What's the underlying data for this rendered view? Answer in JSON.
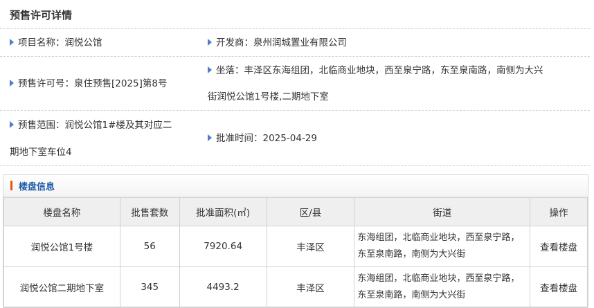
{
  "page": {
    "title": "预售许可详情"
  },
  "info": {
    "project_name": "项目名称：润悦公馆",
    "developer": "开发商：泉州润城置业有限公司",
    "permit_no": "预售许可号：泉住预售[2025]第8号",
    "location_line1": "坐落：丰泽区东海组团，北临商业地块，西至泉宁路，东至泉南路，南侧为大兴",
    "location_line2": "街润悦公馆1号楼,二期地下室",
    "scope_line1": "预售范围：润悦公馆1#楼及其对应二",
    "scope_line2": "期地下室车位4",
    "approval_time": "批准时间：2025-04-29"
  },
  "section": {
    "title": "楼盘信息",
    "columns": [
      "楼盘名称",
      "批售套数",
      "批准面积(㎡)",
      "区/县",
      "街道",
      "操作"
    ],
    "rows": [
      {
        "name": "润悦公馆1号楼",
        "units": "56",
        "area": "7920.64",
        "district": "丰泽区",
        "street_line1": "东海组团，北临商业地块，西至泉宁路，",
        "street_line2": "东至泉南路，南侧为大兴街",
        "action": "查看楼盘"
      },
      {
        "name": "润悦公馆二期地下室",
        "units": "345",
        "area": "4493.2",
        "district": "丰泽区",
        "street_line1": "东海组团，北临商业地块，西至泉宁路，",
        "street_line2": "东至泉南路，南侧为大兴街",
        "action": "查看楼盘"
      }
    ]
  },
  "colors": {
    "accent_blue": "#1d5aa6",
    "marker_orange": "#e8540c",
    "triangle": "#4f7fc2"
  }
}
